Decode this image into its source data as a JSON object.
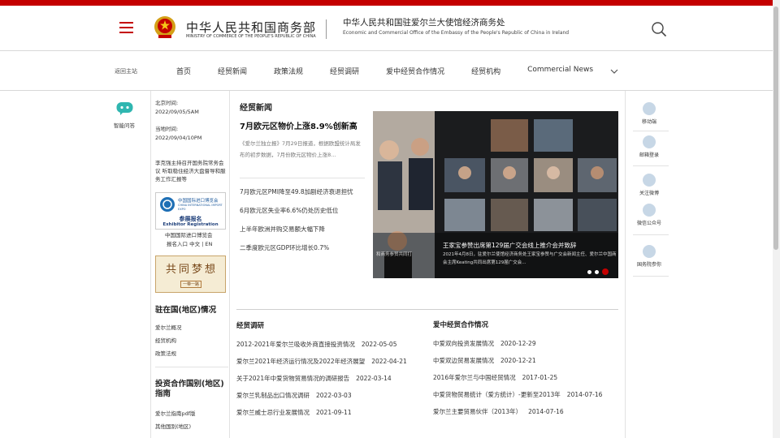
{
  "header": {
    "ministry_cn": "中华人民共和国商务部",
    "ministry_en": "MINISTRY OF COMMERCE OF THE PEOPLE'S REPUBLIC OF CHINA",
    "office_cn": "中华人民共和国驻爱尔兰大使馆经济商务处",
    "office_en": "Economic and Commercial Office of the Embassy of the People's Republic of China in Ireland"
  },
  "nav": {
    "home_link": "返回主站",
    "items": [
      "首页",
      "经贸新闻",
      "政策法规",
      "经贸调研",
      "爱中经贸合作情况",
      "经贸机构",
      "Commercial News"
    ]
  },
  "left_rail": {
    "chat_label": "智能问答"
  },
  "left_col": {
    "beijing_label": "北京时间:",
    "beijing_time": "2022/09/05/5AM",
    "local_label": "当地时间:",
    "local_time": "2022/09/04/10PM",
    "notice": "李克强主持召开国务院常务会议 听取稳住经济大盘督导和服务工作汇报等",
    "expo_cn": "中国国际进口博览会",
    "expo_en": "CHINA INTERNATIONAL IMPORT EXPO",
    "expo_reg_cn": "参展报名",
    "expo_reg_en": "Exhibitor Registration",
    "expo_link1": "中国国际进口博览会",
    "expo_link2": "报名入口 中文 | EN",
    "banner_text": "共同梦想",
    "banner_sub": "一带一路",
    "region_title": "驻在国(地区)情况",
    "region_links": [
      "爱尔兰概况",
      "经贸机构",
      "政策法规"
    ],
    "guide_title": "投资合作国别(地区)指南",
    "guide_links": [
      "爱尔兰指南pdf版",
      "其他国别(地区)"
    ]
  },
  "news": {
    "section_title": "经贸新闻",
    "headline": "7月欧元区物价上涨8.9%创新高",
    "summary": "《爱尔兰独立报》7月29日报道，根据欧盟统计局发布的初步数据，7月份欧元区物价上涨8...",
    "links": [
      "7月欧元区PMI降至49.8加剧经济衰退担忧",
      "6月欧元区失业率6.6%仍处历史低位",
      "上半年欧洲并购交易额大幅下降",
      "二季度欧元区GDP环比增长0.7%"
    ],
    "photo_caption": "王家宝参赞出席第129届广交会线上推介会并致辞",
    "photo_summary": "2021年4月8日，驻爱尔兰使馆经济商务处王家宝参赞与广交会新闻主任、爱尔兰中国商会主席Keating共同出席第129届广交会...",
    "photo_side": "和商务参赞共同打"
  },
  "research": {
    "title": "经贸调研",
    "rows": [
      {
        "text": "2012-2021年爱尔兰吸收外商直接投资情况",
        "date": "2022-05-05"
      },
      {
        "text": "爱尔兰2021年经济运行情况及2022年经济展望",
        "date": "2022-04-21"
      },
      {
        "text": "关于2021年中爱货物贸易情况的调研报告",
        "date": "2022-03-14"
      },
      {
        "text": "爱尔兰乳制品出口情况调研",
        "date": "2022-03-03"
      },
      {
        "text": "爱尔兰威士忌行业发展情况",
        "date": "2021-09-11"
      }
    ]
  },
  "cooperation": {
    "title": "爱中经贸合作情况",
    "rows": [
      {
        "text": "中爱双向投资发展情况",
        "date": "2020-12-29"
      },
      {
        "text": "中爱双边贸易发展情况",
        "date": "2020-12-21"
      },
      {
        "text": "2016年爱尔兰与中国经贸情况",
        "date": "2017-01-25"
      },
      {
        "text": "中爱货物贸易统计（爱方统计）-更新至2013年",
        "date": "2014-07-16"
      },
      {
        "text": "爱尔兰主要贸易伙伴（2013年）",
        "date": "2014-07-16"
      }
    ]
  },
  "right_rail": {
    "items": [
      "移动端",
      "邮箱登录",
      "关注微博",
      "微信公众号",
      "国务院参你"
    ]
  },
  "colors": {
    "brand_red": "#c40000",
    "rail_icon": "#c7d7e6"
  }
}
